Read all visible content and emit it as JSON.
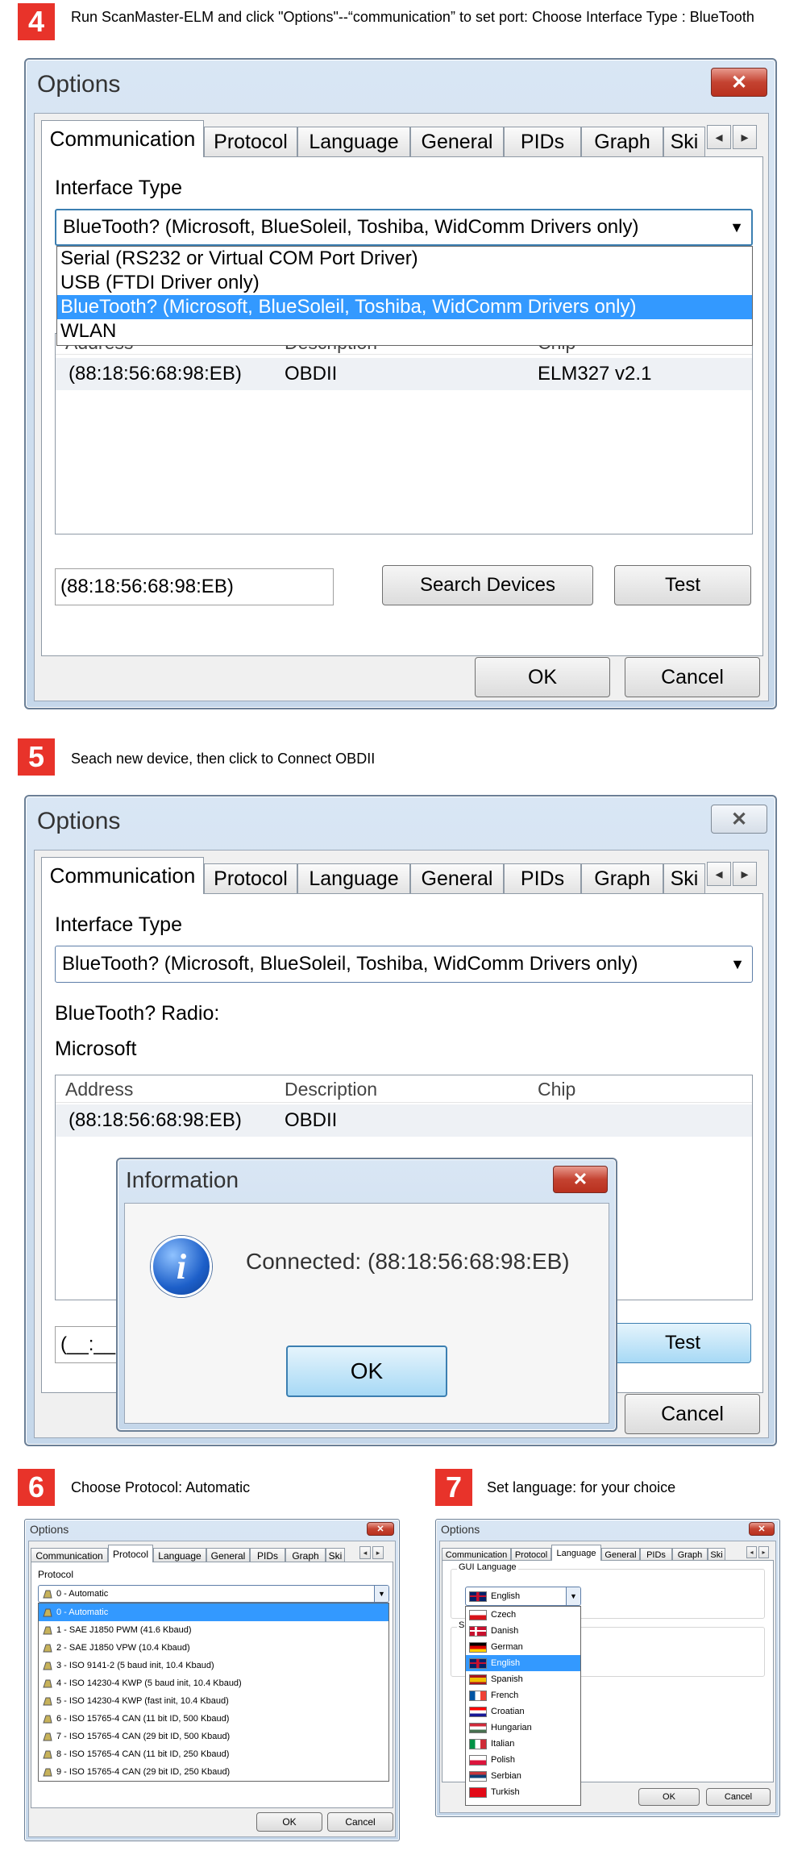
{
  "steps": {
    "s4": {
      "num": "4",
      "text": "Run ScanMaster-ELM and click \"Options\"--“communication” to set port: Choose Interface Type : BlueTooth"
    },
    "s5": {
      "num": "5",
      "text": "Seach new device, then click to Connect OBDII"
    },
    "s6": {
      "num": "6",
      "text": "Choose Protocol: Automatic"
    },
    "s7": {
      "num": "7",
      "text": "Set language: for your choice"
    }
  },
  "win_title": "Options",
  "close_glyph": "✕",
  "tabs": [
    "Communication",
    "Protocol",
    "Language",
    "General",
    "PIDs",
    "Graph",
    "Ski"
  ],
  "scroll": {
    "left": "◂",
    "right": "▸"
  },
  "dropdown_glyph": "▼",
  "comm": {
    "interface_label": "Interface Type",
    "interface_value": "BlueTooth? (Microsoft, BlueSoleil, Toshiba, WidComm Drivers only)",
    "interface_options": [
      "Serial (RS232 or Virtual COM Port Driver)",
      "USB (FTDI Driver only)",
      "BlueTooth? (Microsoft, BlueSoleil, Toshiba, WidComm Drivers only)",
      "WLAN"
    ],
    "radio_label": "BlueTooth? Radio:",
    "radio_value": "Microsoft",
    "columns": [
      "Address",
      "Description",
      "Chip"
    ],
    "row": {
      "address": "(88:18:56:68:98:EB)",
      "description": "OBDII",
      "chip": "ELM327 v2.1"
    },
    "address_field": "(88:18:56:68:98:EB)",
    "address_field_partial": "(__:__",
    "search_button": "Search Devices",
    "test_button": "Test",
    "ok_button": "OK",
    "cancel_button": "Cancel"
  },
  "info": {
    "title": "Information",
    "icon": "i",
    "message": "Connected: (88:18:56:68:98:EB)",
    "ok": "OK"
  },
  "protocol": {
    "label": "Protocol",
    "value": "0 - Automatic",
    "options": [
      "0 - Automatic",
      "1 - SAE J1850 PWM (41.6 Kbaud)",
      "2 - SAE J1850 VPW (10.4 Kbaud)",
      "3 - ISO 9141-2 (5 baud init, 10.4 Kbaud)",
      "4 - ISO 14230-4 KWP (5 baud init, 10.4 Kbaud)",
      "5 - ISO 14230-4 KWP (fast init, 10.4 Kbaud)",
      "6 - ISO 15765-4 CAN (11 bit ID, 500 Kbaud)",
      "7 - ISO 15765-4 CAN (29 bit ID, 500 Kbaud)",
      "8 - ISO 15765-4 CAN (11 bit ID, 250 Kbaud)",
      "9 - ISO 15765-4 CAN (29 bit ID, 250 Kbaud)"
    ]
  },
  "language": {
    "label": "GUI Language",
    "value": "English",
    "s_label": "S",
    "options": [
      "Czech",
      "Danish",
      "German",
      "English",
      "Spanish",
      "French",
      "Croatian",
      "Hungarian",
      "Italian",
      "Polish",
      "Serbian",
      "Turkish"
    ]
  },
  "colors": {
    "step": "#e8332a",
    "selection": "#3399ff",
    "close": "#c44331"
  }
}
